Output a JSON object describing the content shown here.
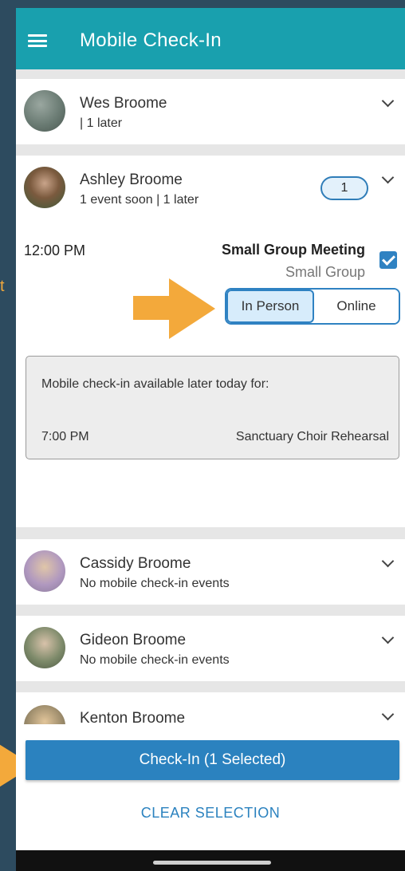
{
  "header": {
    "title": "Mobile Check-In",
    "menu_icon": "hamburger-menu-icon"
  },
  "side": {
    "text": "t"
  },
  "people": [
    {
      "name": "Wes Broome",
      "sub": "| 1 later",
      "avatar_color": "#6a7b73"
    },
    {
      "name": "Ashley Broome",
      "sub": "1 event soon | 1 later",
      "badge": "1",
      "avatar_color": "#3d5a3a"
    },
    {
      "name": "Cassidy Broome",
      "sub": "No mobile check-in events",
      "avatar_color": "#a08bb0"
    },
    {
      "name": "Gideon Broome",
      "sub": "No mobile check-in events",
      "avatar_color": "#5a6b50"
    },
    {
      "name": "Kenton Broome",
      "sub": "",
      "avatar_color": "#7a7a6a"
    }
  ],
  "event": {
    "time": "12:00 PM",
    "name": "Small Group Meeting",
    "group": "Small Group",
    "checked": true,
    "options": [
      "In Person",
      "Online"
    ],
    "selected_option": "In Person"
  },
  "later": {
    "title": "Mobile check-in available later today for:",
    "time": "7:00 PM",
    "name": "Sanctuary Choir Rehearsal"
  },
  "footer": {
    "checkin_label": "Check-In (1 Selected)",
    "clear_label": "CLEAR SELECTION"
  },
  "colors": {
    "header": "#19a0ae",
    "primary": "#2b82bf",
    "accent_arrow": "#f3a93b"
  }
}
